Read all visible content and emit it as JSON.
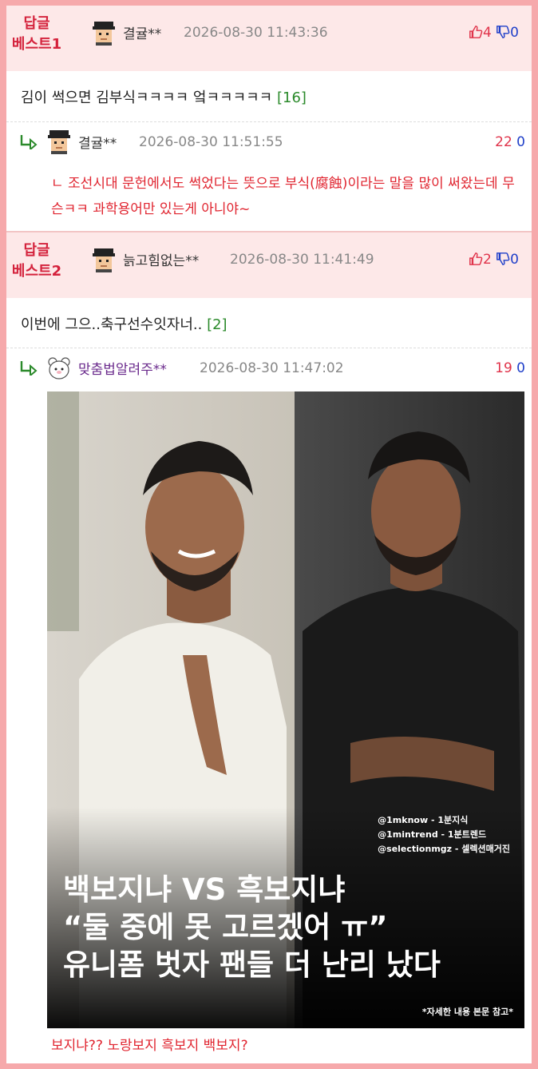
{
  "best1": {
    "rank_line1": "답글",
    "rank_line2": "베스트1",
    "author": "결귤**",
    "date": "2026-08-30 11:43:36",
    "up": "4",
    "down": "0",
    "content": "김이 썩으면 김부식ㅋㅋㅋㅋ 엌ㅋㅋㅋㅋㅋ",
    "reply_count": "[16]"
  },
  "reply1": {
    "author": "결귤**",
    "date": "2026-08-30 11:51:55",
    "up": "22",
    "down": "0",
    "text": "ㄴ 조선시대 문헌에서도 썩었다는 뜻으로 부식(腐蝕)이라는 말을 많이 써왔는데 무슨ㅋㅋ 과학용어만 있는게 아니야~"
  },
  "best2": {
    "rank_line1": "답글",
    "rank_line2": "베스트2",
    "author": "늙고힘없는**",
    "date": "2026-08-30 11:41:49",
    "up": "2",
    "down": "0",
    "content": "이번에 그으..축구선수잇자너..",
    "reply_count": "[2]"
  },
  "reply2": {
    "author": "맞춤법알려주**",
    "date": "2026-08-30 11:47:02",
    "up": "19",
    "down": "0",
    "image": {
      "credits": [
        "@1mknow - 1분지식",
        "@1mintrend - 1분트렌드",
        "@selectionmgz - 셀렉션매거진"
      ],
      "headline": [
        "백보지냐 VS 흑보지냐",
        "“둘 중에 못 고르겠어 ㅠ”",
        "유니폼 벗자 팬들 더 난리 났다"
      ],
      "footnote": "*자세한 내용 본문 참고*"
    },
    "caption": "보지냐?? 노랑보지 흑보지 백보지?"
  },
  "colors": {
    "frame": "#f6a9ab",
    "best_bg": "#fde8e8",
    "rank": "#d4223c",
    "up": "#e0334a",
    "down": "#1f3fc9",
    "reply_text": "#e0242f",
    "count": "#2b8a2b"
  }
}
